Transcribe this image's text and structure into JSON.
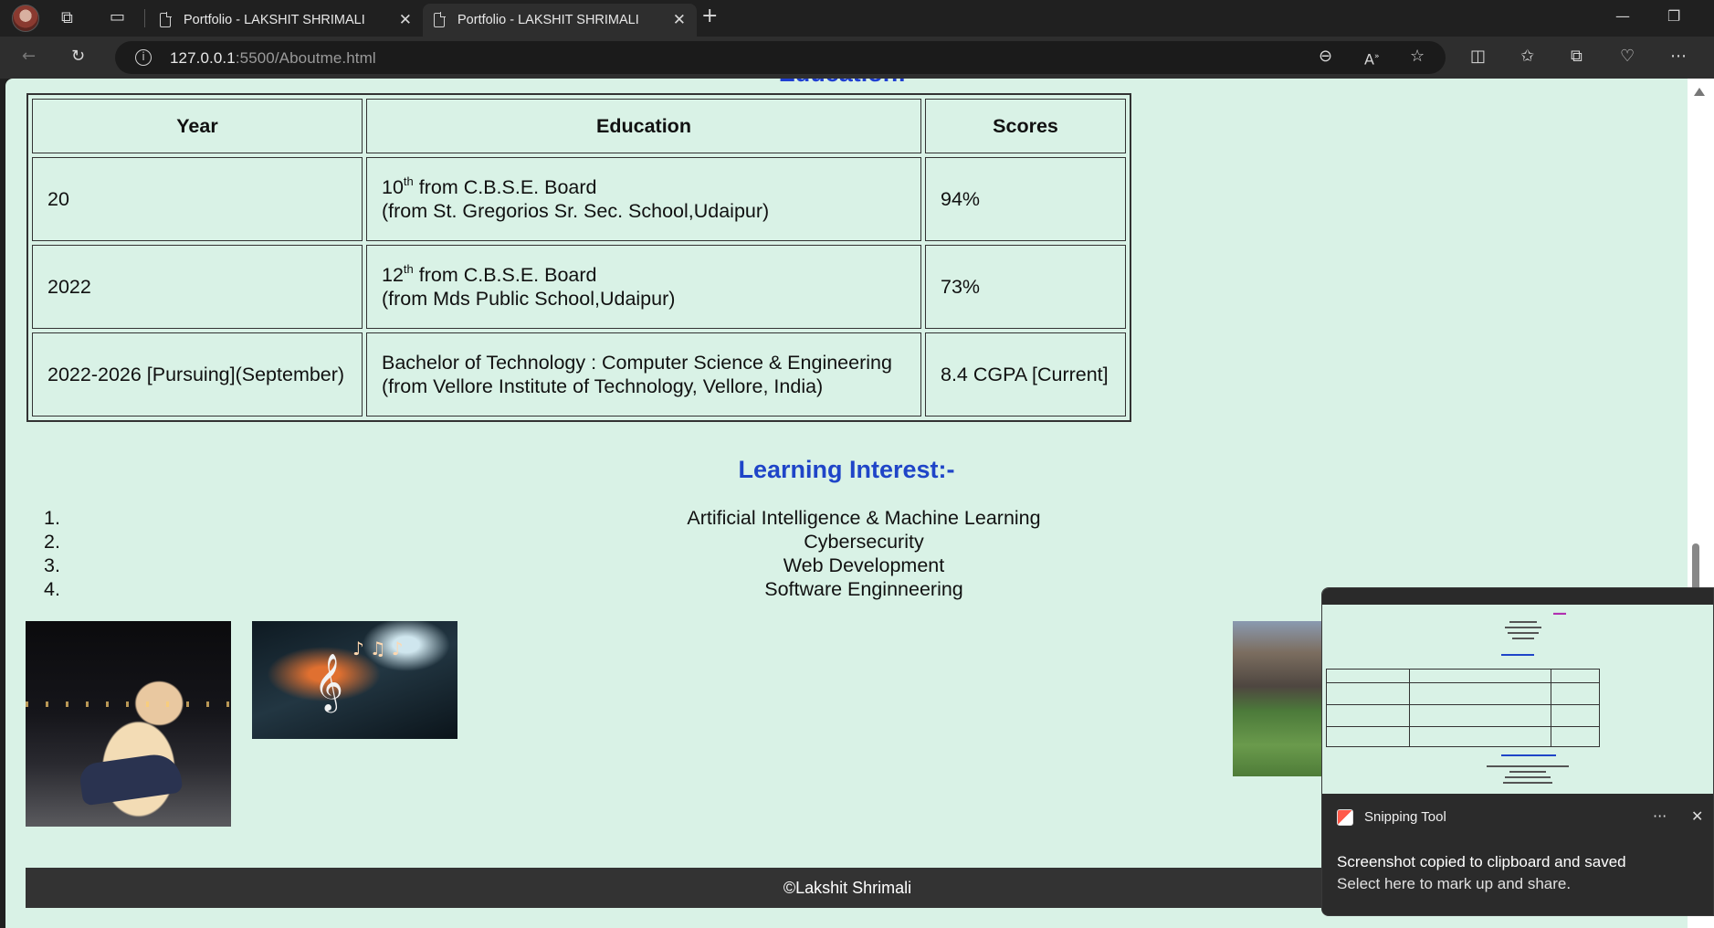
{
  "browser": {
    "tabs": [
      {
        "title": "Portfolio - LAKSHIT SHRIMALI",
        "active": false
      },
      {
        "title": "Portfolio - LAKSHIT SHRIMALI",
        "active": true
      }
    ],
    "new_tab_label": "+",
    "url_host": "127.0.0.1",
    "url_path": ":5500/Aboutme.html",
    "icons": [
      "profile-avatar",
      "workspaces-icon",
      "tab-actions-icon",
      "back-icon",
      "refresh-icon",
      "site-info-icon",
      "zoom-out-icon",
      "read-aloud-icon",
      "favorite-star-icon",
      "split-screen-icon",
      "favorites-icon",
      "collections-icon",
      "browser-essentials-icon",
      "more-icon",
      "minimize-icon",
      "restore-icon"
    ]
  },
  "page": {
    "education_heading_partial": "Education:-",
    "table": {
      "headers": [
        "Year",
        "Education",
        "Scores"
      ],
      "rows": [
        {
          "year": "20",
          "edu_num": "10",
          "edu_sup": "th",
          "edu_line1": " from C.B.S.E. Board",
          "edu_line2": "(from St. Gregorios Sr. Sec. School,Udaipur)",
          "score": "94%"
        },
        {
          "year": "2022",
          "edu_num": "12",
          "edu_sup": "th",
          "edu_line1": " from C.B.S.E. Board",
          "edu_line2": "(from Mds Public School,Udaipur)",
          "score": "73%"
        },
        {
          "year": "2022-2026 [Pursuing](September)",
          "edu_num": "",
          "edu_sup": "",
          "edu_line1": "Bachelor of Technology : Computer Science & Engineering",
          "edu_line2": "(from Vellore Institute of Technology, Vellore, India)",
          "score": "8.4 CGPA [Current]"
        }
      ]
    },
    "learning_heading": "Learning Interest:-",
    "learning_items": [
      {
        "num": "1.",
        "text": "Artificial Intelligence & Machine Learning"
      },
      {
        "num": "2.",
        "text": "Cybersecurity"
      },
      {
        "num": "3.",
        "text": "Web Development"
      },
      {
        "num": "4.",
        "text": "Software Enginneering"
      }
    ],
    "footer": "©Lakshit Shrimali"
  },
  "toast": {
    "app": "Snipping Tool",
    "title": "Screenshot copied to clipboard and saved",
    "subtitle": "Select here to mark up and share.",
    "more": "···",
    "close": "✕"
  },
  "colors": {
    "page_bg": "#d9f2e6",
    "heading_blue": "#1f45c8",
    "footer_bg": "#333333",
    "chrome_bg": "#202020"
  }
}
